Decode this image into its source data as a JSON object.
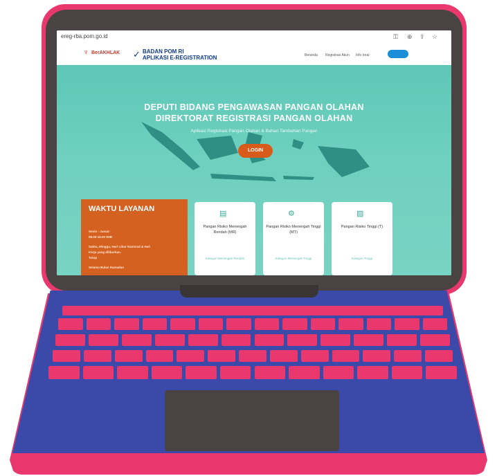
{
  "browser": {
    "url": "ereg-rba.pom.go.id",
    "icons": [
      "key-icon",
      "zoom-icon",
      "share-icon",
      "star-icon"
    ]
  },
  "header": {
    "berakhlak": "BerAKHLAK",
    "org_line1": "BADAN POM RI",
    "org_line2": "APLIKASI E-REGISTRATION",
    "nav": [
      "Beranda",
      "Registrasi Akun",
      "Info Ireal"
    ]
  },
  "hero": {
    "title_line1": "DEPUTI BIDANG PENGAWASAN PANGAN OLAHAN",
    "title_line2": "DIREKTORAT REGISTRASI PANGAN OLAHAN",
    "subtitle": "Aplikasi Registrasi Pangan Olahan & Bahan Tambahan Pangan",
    "login_label": "LOGIN"
  },
  "service_hours": {
    "title": "WAKTU LAYANAN",
    "lines": [
      "Senin - Jumat:",
      "08.00-16.00 WIB",
      "Sabtu, Minggu, Hari Libur Nasional & Hari",
      "Kerja yang diliburkan.",
      "Tutup",
      "Selama Bulan Ramadan"
    ]
  },
  "cards": [
    {
      "title": "Pangan Risiko Menengah Rendah (MR)",
      "link": "Kategori Menengah Rendah"
    },
    {
      "title": "Pangan Risiko Menengah Tinggi (MT)",
      "link": "Kategori Menengah Tinggi"
    },
    {
      "title": "Pangan Risiko Tinggi (T)",
      "link": "Kategori Tinggi"
    }
  ],
  "colors": {
    "laptop_accent": "#e8386e",
    "laptop_body": "#3b4aa8",
    "hero_teal": "#6fd0bf",
    "orange": "#d4611f"
  }
}
